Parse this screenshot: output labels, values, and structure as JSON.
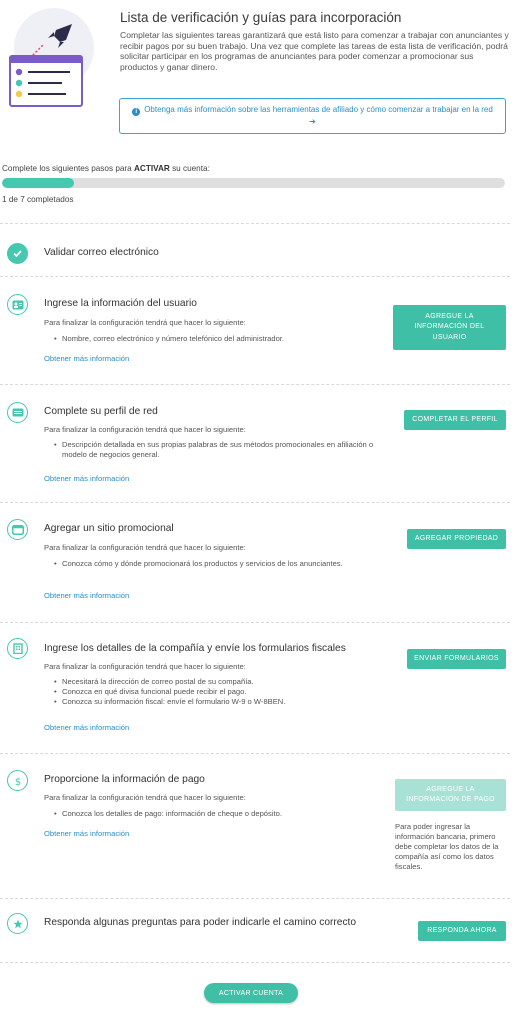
{
  "header": {
    "title": "Lista de verificación y guías para incorporación",
    "description": "Completar las siguientes tareas garantizará que está listo para comenzar a trabajar con anunciantes y recibir pagos por su buen trabajo. Una vez que complete las tareas de esta lista de verificación, podrá solicitar participar en los programas de anunciantes para poder comenzar a promocionar sus productos y ganar dinero.",
    "info_link": "Obtenga más información sobre las herramientas de afiliado y cómo comenzar a trabajar en la red",
    "info_arrow": "➔"
  },
  "progress": {
    "label_prefix": "Complete los siguientes pasos para",
    "label_bold": "ACTIVAR",
    "label_suffix": "su cuenta:",
    "completed": 1,
    "total": 7,
    "count_text": "1 de 7 completados"
  },
  "steps": [
    {
      "icon": "check-icon",
      "title": "Validar correo electrónico"
    },
    {
      "icon": "user-card-icon",
      "title": "Ingrese la información del usuario",
      "subtitle": "Para finalizar la configuración tendrá que hacer lo siguiente:",
      "bullets": [
        "Nombre, correo electrónico y número telefónico del administrador."
      ],
      "link": "Obtener más información",
      "button": "AGREGUE LA INFORMACIÓN DEL USUARIO"
    },
    {
      "icon": "profile-card-icon",
      "title": "Complete su perfil de red",
      "subtitle": "Para finalizar la configuración tendrá que hacer lo siguiente:",
      "bullets": [
        "Descripción detallada en sus propias palabras de sus métodos promocionales en afiliación o modelo de negocios general."
      ],
      "link": "Obtener más información",
      "button": "COMPLETAR EL PERFIL"
    },
    {
      "icon": "browser-window-icon",
      "title": "Agregar un sitio promocional",
      "subtitle": "Para finalizar la configuración tendrá que hacer lo siguiente:",
      "bullets": [
        "Conozca cómo y dónde promocionará los productos y servicios de los anunciantes."
      ],
      "link": "Obtener más información",
      "button": "AGREGAR PROPIEDAD"
    },
    {
      "icon": "building-icon",
      "title": "Ingrese los detalles de la compañía y envíe los formularios fiscales",
      "subtitle": "Para finalizar la configuración tendrá que hacer lo siguiente:",
      "bullets": [
        "Necesitará la dirección de correo postal de su compañía.",
        "Conozca en qué divisa funcional puede recibir el pago.",
        "Conozca su información fiscal: envíe el formulario W-9 o W-8BEN."
      ],
      "link": "Obtener más información",
      "button": "ENVIAR FORMULARIOS"
    },
    {
      "icon": "dollar-icon",
      "title": "Proporcione la información de pago",
      "subtitle": "Para finalizar la configuración tendrá que hacer lo siguiente:",
      "bullets": [
        "Conozca los detalles de pago: información de cheque o depósito."
      ],
      "link": "Obtener más información",
      "button": "AGREGUE LA INFORMACIÓN DE PAGO",
      "note": "Para poder ingresar la información bancaria, primero debe completar los datos de la compañía así como los datos fiscales."
    },
    {
      "icon": "star-icon",
      "title": "Responda algunas preguntas para poder indicarle el camino correcto",
      "button": "RESPONDA AHORA"
    }
  ],
  "activate_button": "ACTIVAR CUENTA",
  "colors": {
    "accent": "#46c7b0",
    "button": "#3fc0a6",
    "button_disabled": "#a8e2d6",
    "link": "#2a8fc7",
    "illustration_purple": "#7a5cc6"
  }
}
